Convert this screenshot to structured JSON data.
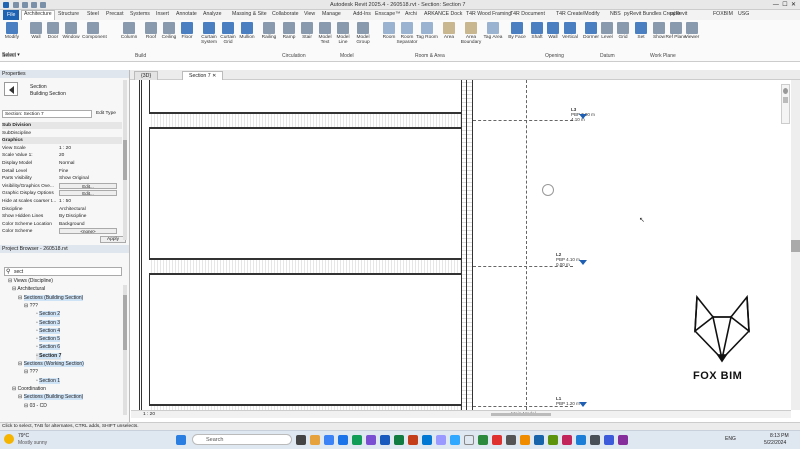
{
  "window": {
    "title": "Autodesk Revit 2025.4 - 260518.rvt - Section: Section 7"
  },
  "ribbon_tabs": [
    "File",
    "Architecture",
    "Structure",
    "Steel",
    "Precast",
    "Systems",
    "Insert",
    "Annotate",
    "Analyze",
    "Massing & Site",
    "Collaborate",
    "View",
    "Manage",
    "Add-Ins",
    "Enscape™",
    "Archi",
    "ARKANCE Dock",
    "T4R Wood Framing",
    "T4R Document",
    "T4R Create/Modify",
    "NBS",
    "pyRevit Bundles Creator",
    "pyRevit",
    "FOXBIM",
    "USG"
  ],
  "ribbon_buttons": [
    "Modify",
    "Wall",
    "Door",
    "Window",
    "Component",
    "Column",
    "Roof",
    "Ceiling",
    "Floor",
    "Curtain System",
    "Curtain Grid",
    "Mullion",
    "Railing",
    "Ramp",
    "Stair",
    "Model Text",
    "Model Line",
    "Model Group",
    "Room",
    "Room Separator",
    "Tag Room",
    "Area",
    "Area Boundary",
    "Tag Area",
    "By Face",
    "Shaft",
    "Wall",
    "Vertical",
    "Dormer",
    "Level",
    "Grid",
    "Set",
    "Show",
    "Ref Plane",
    "Viewer"
  ],
  "ribbon_groups": [
    "Select",
    "Build",
    "Circulation",
    "Model",
    "Room & Area",
    "Opening",
    "Datum",
    "Work Plane"
  ],
  "select_label": "Select ▾",
  "view_tabs": [
    "{3D}",
    "Section 7"
  ],
  "properties": {
    "title": "Properties",
    "type_name": "Section",
    "type_sub": "Building Section",
    "selector": "Section: Section 7",
    "edit_type": "Edit Type",
    "rows": [
      {
        "k": "Sub Division",
        "v": ""
      },
      {
        "k": "SubDiscipline",
        "v": ""
      },
      {
        "k": "Graphics",
        "v": ""
      },
      {
        "k": "View Scale",
        "v": "1 : 20"
      },
      {
        "k": "Scale Value  1:",
        "v": "20"
      },
      {
        "k": "Display Model",
        "v": "Normal"
      },
      {
        "k": "Detail Level",
        "v": "Fine"
      },
      {
        "k": "Parts Visibility",
        "v": "Show Original"
      },
      {
        "k": "Visibility/Graphics Ove...",
        "v": "Edit..."
      },
      {
        "k": "Graphic Display Options",
        "v": "Edit..."
      },
      {
        "k": "Hide at scales coarser t...",
        "v": "1 : 50"
      },
      {
        "k": "Discipline",
        "v": "Architectural"
      },
      {
        "k": "Show Hidden Lines",
        "v": "By Discipline"
      },
      {
        "k": "Color Scheme Location",
        "v": "Background"
      },
      {
        "k": "Color Scheme",
        "v": "<none>"
      }
    ],
    "apply": "Apply"
  },
  "browser": {
    "title": "Project Browser - 260518.rvt",
    "search": "sect",
    "items": [
      "Views (Discipline)",
      "Architectural",
      "Sections (Building Section)",
      "???",
      "Section 2",
      "Section 3",
      "Section 4",
      "Section 5",
      "Section 6",
      "Section 7",
      "Sections (Working Section)",
      "???",
      "Section 1",
      "Coordination",
      "Sections (Building Section)",
      "03 - CD"
    ]
  },
  "levels": [
    {
      "name": "L3",
      "elev": "PBP 7.00 m",
      "sub": "4.10 m"
    },
    {
      "name": "L2",
      "elev": "PBP 4.10 m",
      "sub": "0.00 m"
    },
    {
      "name": "L1",
      "elev": "PBP 1.20 m",
      "sub": "0.00 m"
    }
  ],
  "logo": {
    "text": "FOX BIM"
  },
  "viewbar": {
    "scale": "1 : 20",
    "mode": "Main Model"
  },
  "status": {
    "text": "Click to select, TAB for alternates, CTRL adds, SHIFT unselects."
  },
  "taskbar": {
    "weather": "79°C",
    "weather_sub": "Mostly sunny",
    "search": "Search",
    "lang": "ENG",
    "time": "8:13 PM",
    "date": "5/22/2024"
  },
  "colors": {
    "accent": "#1f63b3",
    "level_marker": "#1f5fb3"
  }
}
